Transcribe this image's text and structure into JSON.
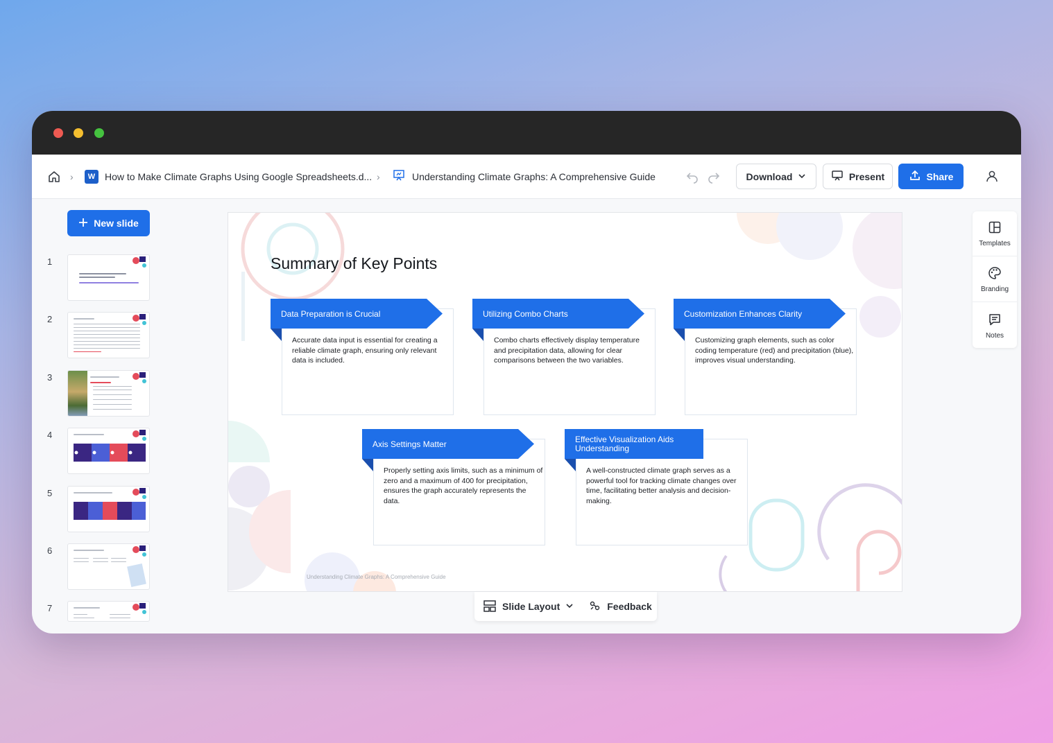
{
  "toolbar": {
    "document_name": "How to Make Climate Graphs Using Google Spreadsheets.d...",
    "presentation_name": "Understanding Climate Graphs: A Comprehensive Guide",
    "word_icon_letter": "W",
    "download_label": "Download",
    "present_label": "Present",
    "share_label": "Share"
  },
  "sidebar": {
    "new_slide_label": "New slide",
    "slides": [
      {
        "num": "1"
      },
      {
        "num": "2"
      },
      {
        "num": "3"
      },
      {
        "num": "4"
      },
      {
        "num": "5"
      },
      {
        "num": "6"
      },
      {
        "num": "7"
      }
    ]
  },
  "slide": {
    "title": "Summary of Key Points",
    "footer": "Understanding Climate Graphs: A Comprehensive Guide",
    "cards": [
      {
        "heading": "Data Preparation is Crucial",
        "body": "Accurate data input is essential for creating a reliable climate graph, ensuring only relevant data is included."
      },
      {
        "heading": "Utilizing Combo Charts",
        "body": "Combo charts effectively display temperature and precipitation data, allowing for clear comparisons between the two variables."
      },
      {
        "heading": "Customization Enhances Clarity",
        "body": "Customizing graph elements, such as color coding temperature (red) and precipitation (blue), improves visual understanding."
      },
      {
        "heading": "Axis Settings Matter",
        "body": "Properly setting axis limits, such as a minimum of zero and a maximum of 400 for precipitation, ensures the graph accurately represents the data."
      },
      {
        "heading": "Effective Visualization Aids Understanding",
        "body": "A well-constructed climate graph serves as a powerful tool for tracking climate changes over time, facilitating better analysis and decision-making."
      }
    ]
  },
  "bottom_bar": {
    "slide_layout_label": "Slide Layout",
    "feedback_label": "Feedback"
  },
  "right_panel": {
    "templates_label": "Templates",
    "branding_label": "Branding",
    "notes_label": "Notes"
  },
  "colors": {
    "primary": "#1f6fe8",
    "titlebar": "#262626"
  }
}
